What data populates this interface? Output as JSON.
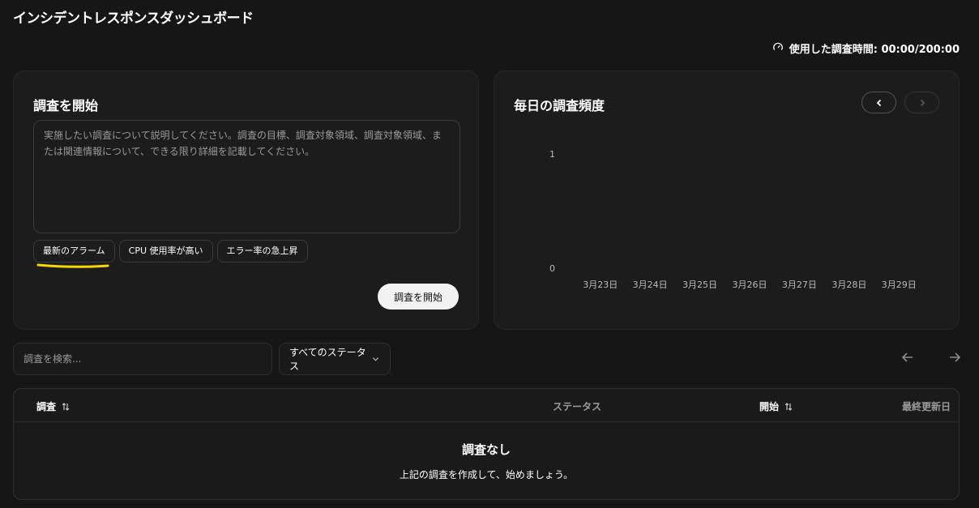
{
  "app": {
    "title": "インシデントレスポンスダッシュボード"
  },
  "usage": {
    "label": "使用した調査時間: 00:00/200:00"
  },
  "start_card": {
    "title": "調査を開始",
    "placeholder": "実施したい調査について説明してください。調査の目標、調査対象領域、調査対象領域、または関連情報について、できる限り詳細を記載してください。",
    "chips": [
      "最新のアラーム",
      "CPU 使用率が高い",
      "エラー率の急上昇"
    ],
    "submit_label": "調査を開始",
    "highlight_color": "#f5d800"
  },
  "chart_card": {
    "title": "毎日の調査頻度"
  },
  "chart_data": {
    "type": "bar",
    "categories": [
      "3月23日",
      "3月24日",
      "3月25日",
      "3月26日",
      "3月27日",
      "3月28日",
      "3月29日"
    ],
    "values": [
      0,
      0,
      0,
      0,
      0,
      0,
      0
    ],
    "ylim": [
      0,
      1
    ],
    "yticks": [
      "1",
      "0"
    ],
    "grid": false
  },
  "filters": {
    "search_placeholder": "調査を検索...",
    "status_label": "すべてのステータス"
  },
  "table": {
    "columns": [
      "調査",
      "ステータス",
      "開始",
      "最終更新日"
    ],
    "empty_title": "調査なし",
    "empty_subtitle": "上記の調査を作成して、始めましょう。"
  }
}
